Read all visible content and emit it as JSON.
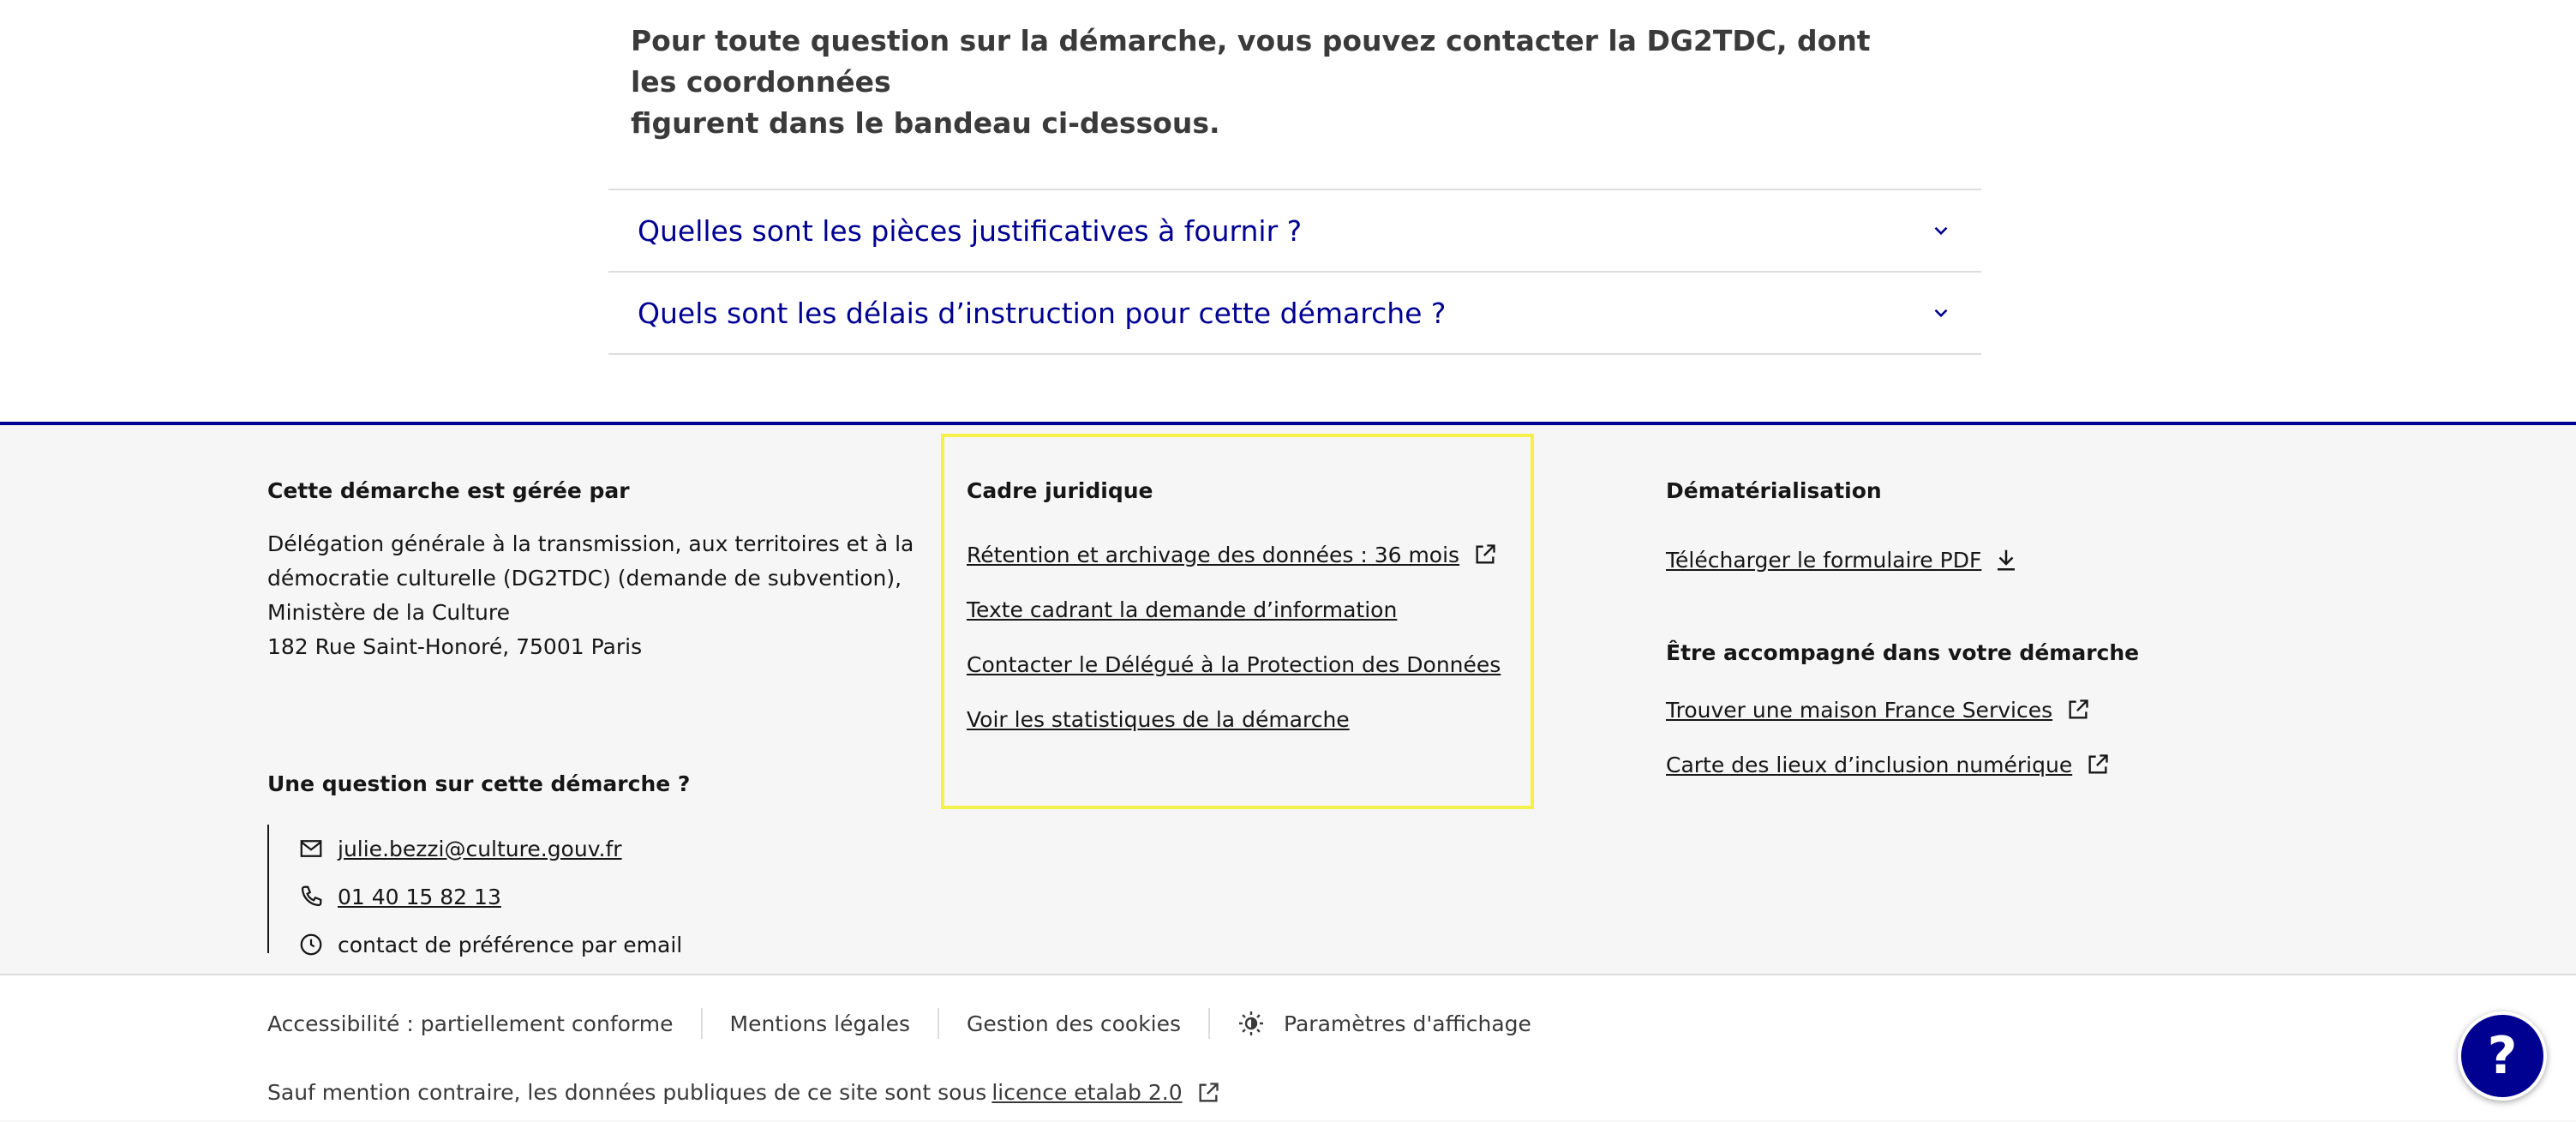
{
  "intro": {
    "line1": "Pour toute question sur la démarche, vous pouvez contacter la DG2TDC, dont les coordonnées",
    "line2": "figurent dans le bandeau ci-dessous."
  },
  "accordion": [
    {
      "label": "Quelles sont les pièces justificatives à fournir ?"
    },
    {
      "label": "Quels sont les délais d’instruction pour cette démarche ?"
    }
  ],
  "footer": {
    "managed": {
      "title": "Cette démarche est gérée par",
      "address": [
        "Délégation générale à la transmission, aux territoires et à la",
        "démocratie culturelle (DG2TDC) (demande de subvention),",
        "Ministère de la Culture",
        "182 Rue Saint-Honoré, 75001 Paris"
      ],
      "question_title": "Une question sur cette démarche ?",
      "email": "julie.bezzi@culture.gouv.fr",
      "phone": "01 40 15 82 13",
      "hours": "contact de préférence par email"
    },
    "legal": {
      "title": "Cadre juridique",
      "links": [
        "Rétention et archivage des données : 36 mois",
        "Texte cadrant la demande d’information",
        "Contacter le Délégué à la Protection des Données",
        "Voir les statistiques de la démarche"
      ]
    },
    "digital": {
      "title": "Dématérialisation",
      "download": "Télécharger le formulaire PDF",
      "support_title": "Être accompagné dans votre démarche",
      "support_links": [
        "Trouver une maison France Services",
        "Carte des lieux d’inclusion numérique"
      ]
    },
    "bottom": {
      "accessibility": "Accessibilité : partiellement conforme",
      "mentions": "Mentions légales",
      "cookies": "Gestion des cookies",
      "display": "Paramètres d'affichage",
      "license_text": "Sauf mention contraire, les données publiques de ce site sont sous",
      "license_link": "licence etalab 2.0"
    },
    "help": "?"
  },
  "colors": {
    "primary": "#000091",
    "footer_bg": "#f6f6f6",
    "highlight": "#f5f14a"
  }
}
